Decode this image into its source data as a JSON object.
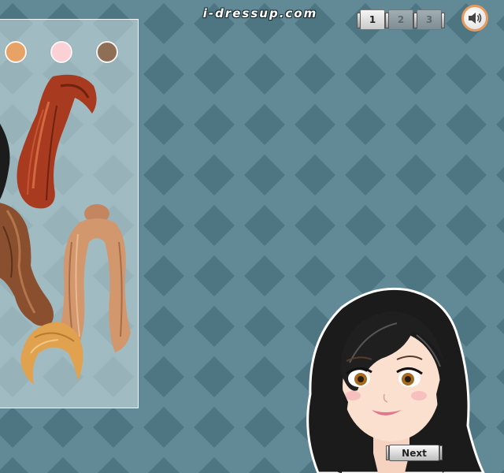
{
  "header": {
    "site_logo_text": "i-dressup.com",
    "page_tabs": [
      {
        "label": "1",
        "state": "active"
      },
      {
        "label": "2",
        "state": "inactive"
      },
      {
        "label": "3",
        "state": "inactive"
      }
    ],
    "sound_icon": "speaker-icon"
  },
  "hair_panel": {
    "color_swatches": [
      {
        "name": "orange",
        "color": "#e8a266"
      },
      {
        "name": "pink",
        "color": "#fbd1d6"
      },
      {
        "name": "brown",
        "color": "#8e6e55"
      }
    ],
    "hair_styles": [
      {
        "name": "red-side-swept",
        "color": "#a83a1f"
      },
      {
        "name": "brown-wavy",
        "color": "#8a4f2e"
      },
      {
        "name": "strawberry-blonde-updo",
        "color": "#d2976c"
      },
      {
        "name": "blonde-short",
        "color": "#e0a24e"
      }
    ]
  },
  "colors": {
    "background": "#5f8793",
    "diamond": "#4f7784",
    "accent_orange": "#e79a5c"
  },
  "footer": {
    "next_label": "Next"
  }
}
